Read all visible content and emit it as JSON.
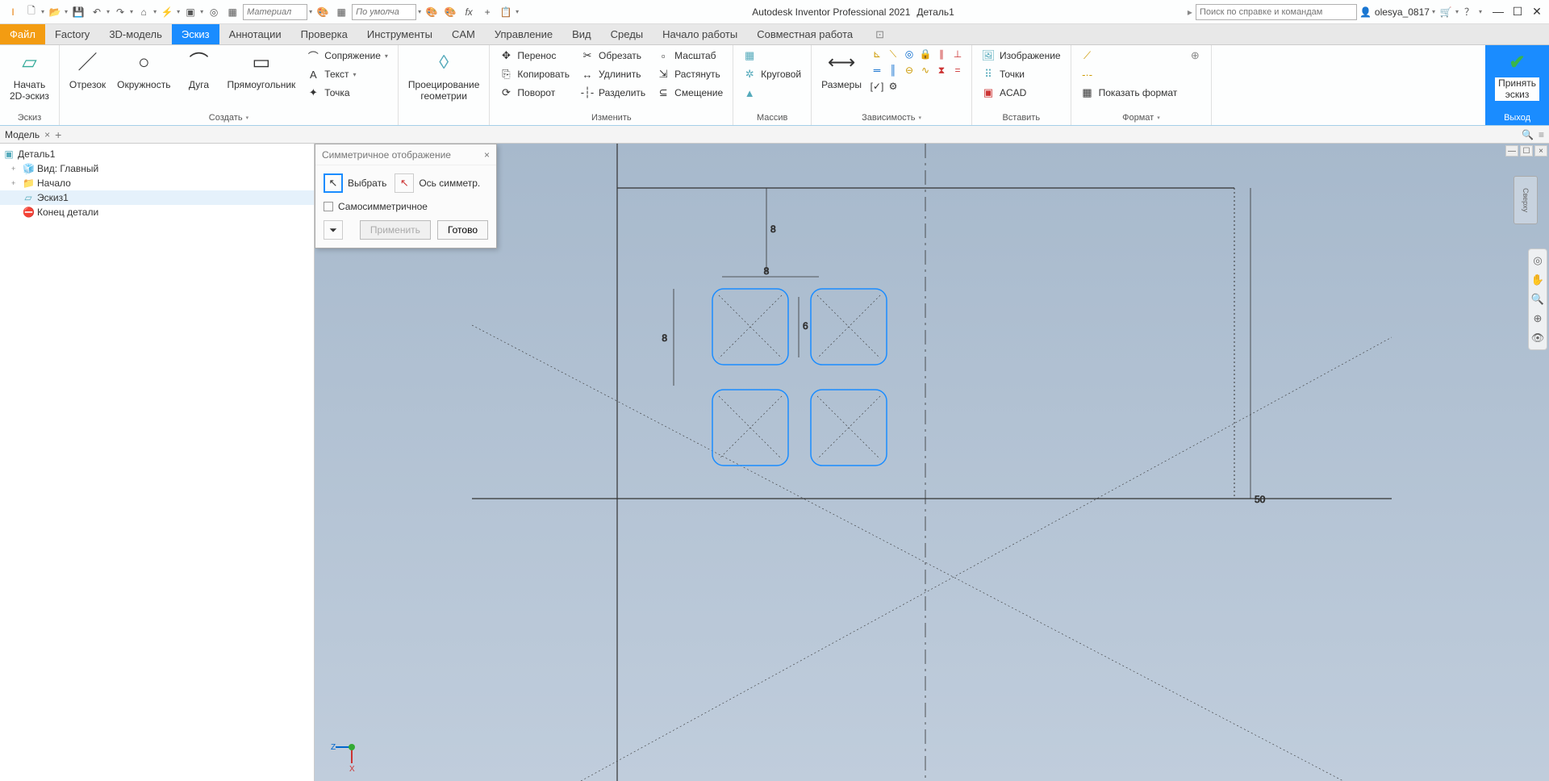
{
  "app": {
    "title": "Autodesk Inventor Professional 2021",
    "doc": "Деталь1"
  },
  "qat": {
    "material_ph": "Материал",
    "appearance_ph": "По умолча",
    "search_ph": "Поиск по справке и командам",
    "user": "olesya_0817"
  },
  "tabs": {
    "file": "Файл",
    "items": [
      "Factory",
      "3D-модель",
      "Эскиз",
      "Аннотации",
      "Проверка",
      "Инструменты",
      "CAM",
      "Управление",
      "Вид",
      "Среды",
      "Начало работы",
      "Совместная работа"
    ],
    "active": "Эскиз"
  },
  "ribbon": {
    "sketch": {
      "start": "Начать\n2D-эскиз",
      "title": "Эскиз"
    },
    "create": {
      "line": "Отрезок",
      "circle": "Окружность",
      "arc": "Дуга",
      "rect": "Прямоугольник",
      "fillet": "Сопряжение",
      "text": "Текст",
      "point": "Точка",
      "title": "Создать"
    },
    "project": {
      "btn": "Проецирование\nгеометрии"
    },
    "modify": {
      "move": "Перенос",
      "copy": "Копировать",
      "rotate": "Поворот",
      "trim": "Обрезать",
      "extend": "Удлинить",
      "split": "Разделить",
      "scale": "Масштаб",
      "stretch": "Растянуть",
      "offset": "Смещение",
      "title": "Изменить"
    },
    "pattern": {
      "rect": "",
      "circ": "Круговой",
      "mirror": "",
      "title": "Массив"
    },
    "dim": {
      "btn": "Размеры",
      "title": "Зависимость"
    },
    "insert": {
      "image": "Изображение",
      "points": "Точки",
      "acad": "ACAD",
      "title": "Вставить"
    },
    "format": {
      "show": "Показать формат",
      "title": "Формат"
    },
    "exit": {
      "btn": "Принять\nэскиз",
      "title": "Выход"
    }
  },
  "browser": {
    "tab": "Модель",
    "root": "Деталь1",
    "items": [
      {
        "label": "Вид: Главный",
        "ico": "🧊"
      },
      {
        "label": "Начало",
        "ico": "📁"
      },
      {
        "label": "Эскиз1",
        "ico": "▱",
        "sel": true
      },
      {
        "label": "Конец детали",
        "ico": "⛔"
      }
    ]
  },
  "dialog": {
    "title": "Симметричное отображение",
    "select": "Выбрать",
    "axis": "Ось симметр.",
    "self": "Самосимметричное",
    "apply": "Применить",
    "done": "Готово"
  },
  "viewcube": "Сверху",
  "dims": {
    "w": "8",
    "h": "8",
    "gap": "6",
    "outer": "50"
  }
}
